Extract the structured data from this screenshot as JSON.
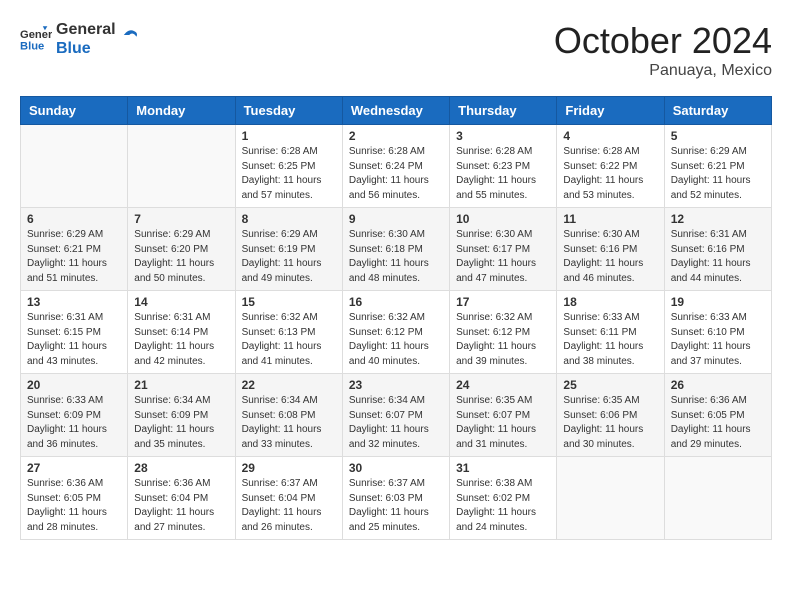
{
  "header": {
    "logo_line1": "General",
    "logo_line2": "Blue",
    "month_title": "October 2024",
    "location": "Panuaya, Mexico"
  },
  "weekdays": [
    "Sunday",
    "Monday",
    "Tuesday",
    "Wednesday",
    "Thursday",
    "Friday",
    "Saturday"
  ],
  "weeks": [
    [
      {
        "day": "",
        "info": ""
      },
      {
        "day": "",
        "info": ""
      },
      {
        "day": "1",
        "info": "Sunrise: 6:28 AM\nSunset: 6:25 PM\nDaylight: 11 hours and 57 minutes."
      },
      {
        "day": "2",
        "info": "Sunrise: 6:28 AM\nSunset: 6:24 PM\nDaylight: 11 hours and 56 minutes."
      },
      {
        "day": "3",
        "info": "Sunrise: 6:28 AM\nSunset: 6:23 PM\nDaylight: 11 hours and 55 minutes."
      },
      {
        "day": "4",
        "info": "Sunrise: 6:28 AM\nSunset: 6:22 PM\nDaylight: 11 hours and 53 minutes."
      },
      {
        "day": "5",
        "info": "Sunrise: 6:29 AM\nSunset: 6:21 PM\nDaylight: 11 hours and 52 minutes."
      }
    ],
    [
      {
        "day": "6",
        "info": "Sunrise: 6:29 AM\nSunset: 6:21 PM\nDaylight: 11 hours and 51 minutes."
      },
      {
        "day": "7",
        "info": "Sunrise: 6:29 AM\nSunset: 6:20 PM\nDaylight: 11 hours and 50 minutes."
      },
      {
        "day": "8",
        "info": "Sunrise: 6:29 AM\nSunset: 6:19 PM\nDaylight: 11 hours and 49 minutes."
      },
      {
        "day": "9",
        "info": "Sunrise: 6:30 AM\nSunset: 6:18 PM\nDaylight: 11 hours and 48 minutes."
      },
      {
        "day": "10",
        "info": "Sunrise: 6:30 AM\nSunset: 6:17 PM\nDaylight: 11 hours and 47 minutes."
      },
      {
        "day": "11",
        "info": "Sunrise: 6:30 AM\nSunset: 6:16 PM\nDaylight: 11 hours and 46 minutes."
      },
      {
        "day": "12",
        "info": "Sunrise: 6:31 AM\nSunset: 6:16 PM\nDaylight: 11 hours and 44 minutes."
      }
    ],
    [
      {
        "day": "13",
        "info": "Sunrise: 6:31 AM\nSunset: 6:15 PM\nDaylight: 11 hours and 43 minutes."
      },
      {
        "day": "14",
        "info": "Sunrise: 6:31 AM\nSunset: 6:14 PM\nDaylight: 11 hours and 42 minutes."
      },
      {
        "day": "15",
        "info": "Sunrise: 6:32 AM\nSunset: 6:13 PM\nDaylight: 11 hours and 41 minutes."
      },
      {
        "day": "16",
        "info": "Sunrise: 6:32 AM\nSunset: 6:12 PM\nDaylight: 11 hours and 40 minutes."
      },
      {
        "day": "17",
        "info": "Sunrise: 6:32 AM\nSunset: 6:12 PM\nDaylight: 11 hours and 39 minutes."
      },
      {
        "day": "18",
        "info": "Sunrise: 6:33 AM\nSunset: 6:11 PM\nDaylight: 11 hours and 38 minutes."
      },
      {
        "day": "19",
        "info": "Sunrise: 6:33 AM\nSunset: 6:10 PM\nDaylight: 11 hours and 37 minutes."
      }
    ],
    [
      {
        "day": "20",
        "info": "Sunrise: 6:33 AM\nSunset: 6:09 PM\nDaylight: 11 hours and 36 minutes."
      },
      {
        "day": "21",
        "info": "Sunrise: 6:34 AM\nSunset: 6:09 PM\nDaylight: 11 hours and 35 minutes."
      },
      {
        "day": "22",
        "info": "Sunrise: 6:34 AM\nSunset: 6:08 PM\nDaylight: 11 hours and 33 minutes."
      },
      {
        "day": "23",
        "info": "Sunrise: 6:34 AM\nSunset: 6:07 PM\nDaylight: 11 hours and 32 minutes."
      },
      {
        "day": "24",
        "info": "Sunrise: 6:35 AM\nSunset: 6:07 PM\nDaylight: 11 hours and 31 minutes."
      },
      {
        "day": "25",
        "info": "Sunrise: 6:35 AM\nSunset: 6:06 PM\nDaylight: 11 hours and 30 minutes."
      },
      {
        "day": "26",
        "info": "Sunrise: 6:36 AM\nSunset: 6:05 PM\nDaylight: 11 hours and 29 minutes."
      }
    ],
    [
      {
        "day": "27",
        "info": "Sunrise: 6:36 AM\nSunset: 6:05 PM\nDaylight: 11 hours and 28 minutes."
      },
      {
        "day": "28",
        "info": "Sunrise: 6:36 AM\nSunset: 6:04 PM\nDaylight: 11 hours and 27 minutes."
      },
      {
        "day": "29",
        "info": "Sunrise: 6:37 AM\nSunset: 6:04 PM\nDaylight: 11 hours and 26 minutes."
      },
      {
        "day": "30",
        "info": "Sunrise: 6:37 AM\nSunset: 6:03 PM\nDaylight: 11 hours and 25 minutes."
      },
      {
        "day": "31",
        "info": "Sunrise: 6:38 AM\nSunset: 6:02 PM\nDaylight: 11 hours and 24 minutes."
      },
      {
        "day": "",
        "info": ""
      },
      {
        "day": "",
        "info": ""
      }
    ]
  ]
}
